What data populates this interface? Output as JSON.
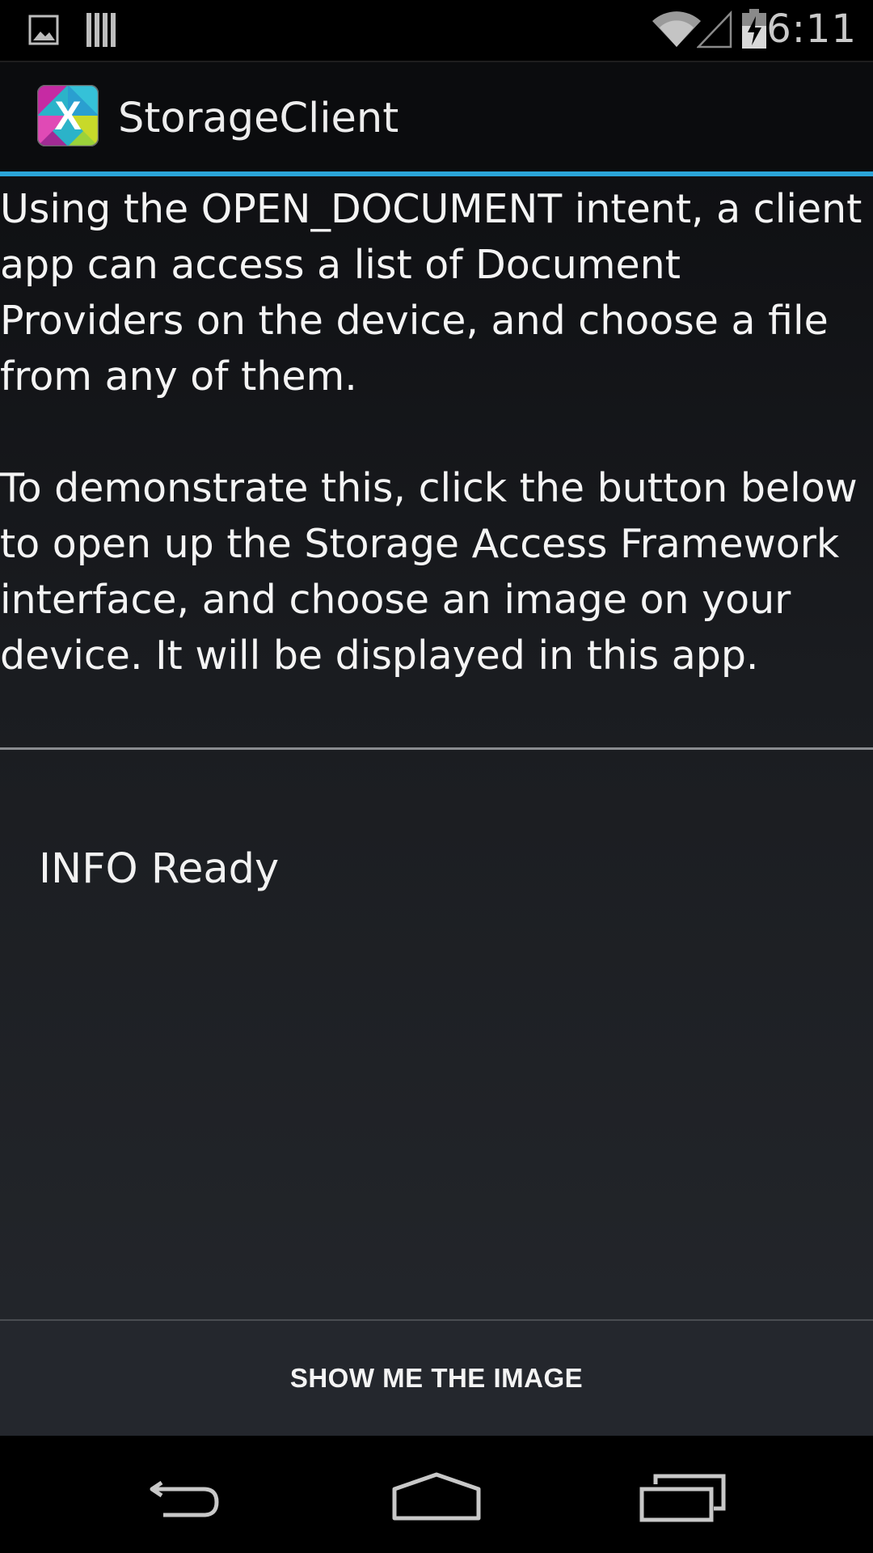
{
  "status_bar": {
    "time": "6:11",
    "icons": [
      "image-notification-icon",
      "barcode-notification-icon",
      "wifi-icon",
      "cell-signal-icon",
      "battery-charging-icon"
    ]
  },
  "action_bar": {
    "title": "StorageClient",
    "app_icon_letter": "X"
  },
  "content": {
    "intro_paragraph_1": "Using the OPEN_DOCUMENT intent, a client app can access a list of Document Providers on the device, and choose a file from any of them.",
    "intro_paragraph_2": "To demonstrate this, click the button below to open up the Storage Access Framework interface, and choose an image on your device. It will be displayed in this app.",
    "log_message": "INFO Ready",
    "button_label": "SHOW ME THE IMAGE"
  },
  "nav_bar": {
    "buttons": [
      "back-icon",
      "home-icon",
      "recents-icon"
    ]
  },
  "colors": {
    "accent": "#2ba4d8",
    "background": "#1a1c20",
    "status_bar": "#000000"
  }
}
